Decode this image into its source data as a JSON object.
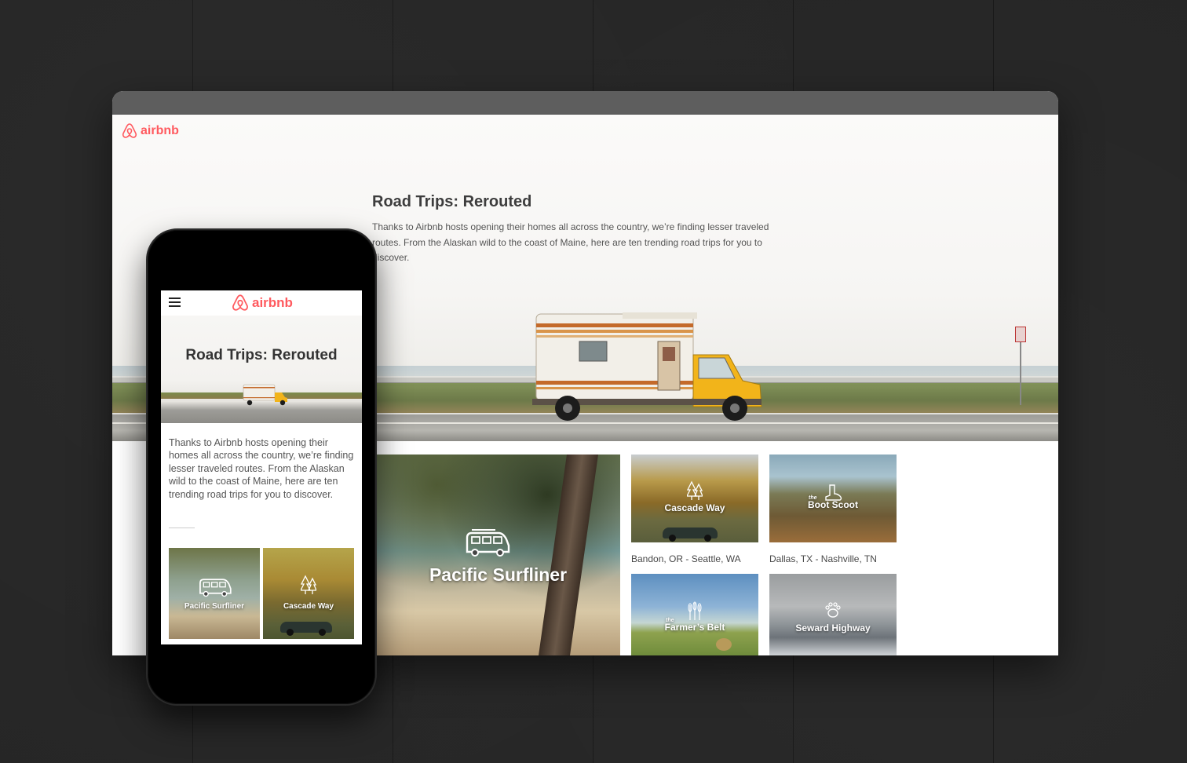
{
  "brand": {
    "name": "airbnb",
    "color": "#ff5a5f"
  },
  "desktop": {
    "title": "Road Trips: Rerouted",
    "intro": "Thanks to Airbnb hosts opening their homes all across the country, we’re finding lesser traveled routes. From the Alaskan wild to the coast of Maine, here are ten trending road trips for you to discover.",
    "tiles": [
      {
        "name": "Pacific Surfliner",
        "icon": "van-icon"
      },
      {
        "name": "Cascade Way",
        "icon": "pine-trees-icon",
        "caption": "Bandon, OR - Seattle, WA"
      },
      {
        "prefix": "the",
        "name": "Boot Scoot",
        "icon": "cowboy-boot-icon",
        "caption": "Dallas, TX - Nashville, TN"
      },
      {
        "prefix": "the",
        "name": "Farmer’s Belt",
        "icon": "wheat-icon"
      },
      {
        "name": "Seward Highway",
        "icon": "bear-paw-icon"
      }
    ]
  },
  "mobile": {
    "title": "Road Trips: Rerouted",
    "intro": "Thanks to Airbnb hosts opening their homes all across the country, we’re finding lesser traveled routes. From the Alaskan wild to the coast of Maine, here are ten trending road trips for you to discover.",
    "tiles": [
      {
        "name": "Pacific Surfliner",
        "icon": "van-icon"
      },
      {
        "name": "Cascade Way",
        "icon": "pine-trees-icon"
      }
    ]
  }
}
